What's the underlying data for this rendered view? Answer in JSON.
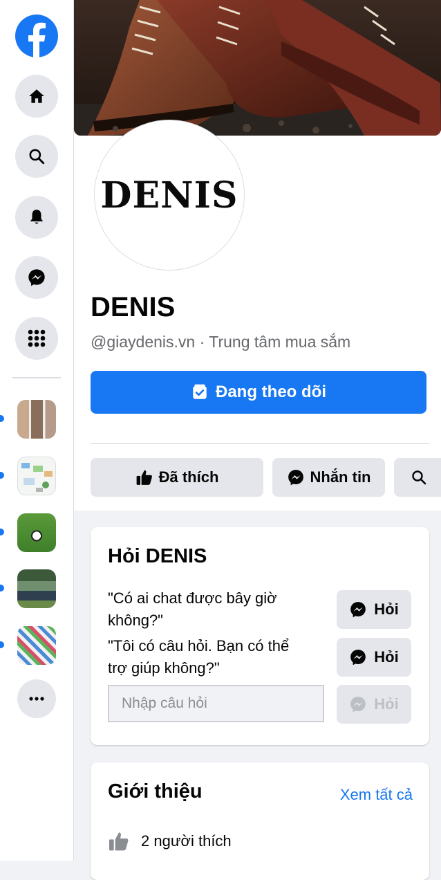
{
  "page": {
    "name": "DENIS",
    "avatar_text": "DENIS",
    "handle": "@giaydenis.vn",
    "separator": "·",
    "category": "Trung tâm mua sắm",
    "follow_label": "Đang theo dõi"
  },
  "actions": {
    "liked_label": "Đã thích",
    "message_label": "Nhắn tin"
  },
  "ask_card": {
    "title": "Hỏi DENIS",
    "questions": [
      {
        "text": "\"Có ai chat được bây giờ không?\"",
        "button": "Hỏi"
      },
      {
        "text": "\"Tôi có câu hỏi. Bạn có thể trợ giúp không?\"",
        "button": "Hỏi"
      }
    ],
    "input_placeholder": "Nhập câu hỏi",
    "submit_label": "Hỏi"
  },
  "intro_card": {
    "title": "Giới thiệu",
    "see_all": "Xem tất cả",
    "likes": "2 người thích"
  },
  "rail": {
    "icons": [
      "facebook-logo",
      "home-icon",
      "search-icon",
      "bell-icon",
      "messenger-icon",
      "menu-grid-icon",
      "more-icon"
    ]
  },
  "colors": {
    "brand": "#1877f2",
    "button_grey": "#e4e6eb",
    "secondary_text": "#65676b"
  }
}
